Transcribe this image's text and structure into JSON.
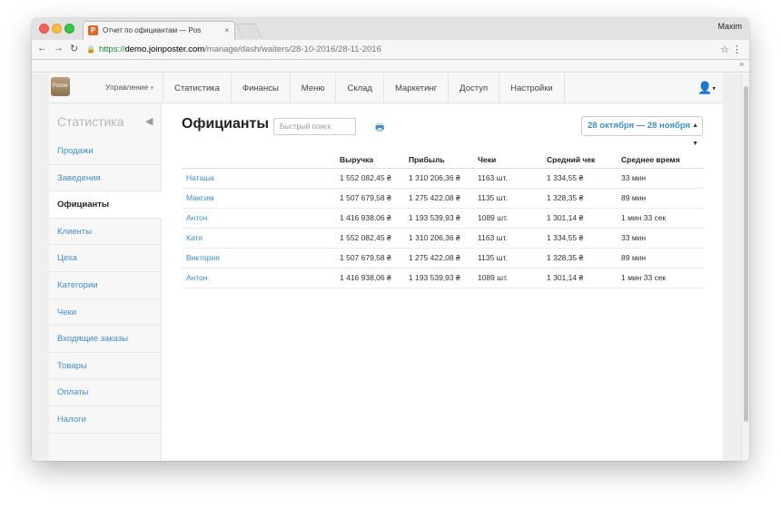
{
  "browser": {
    "tab_title": "Отчет по официантам — Pos",
    "tab_close": "×",
    "user_name": "Maxim",
    "url_secure": "https://",
    "url_host": "demo.joinposter.com",
    "url_path": "/manage/dash/waiters/28-10-2016/28-11-2016"
  },
  "topnav": {
    "logo_text": "Poster",
    "management_label": "Управление",
    "items": [
      "Статистика",
      "Финансы",
      "Меню",
      "Склад",
      "Маркетинг",
      "Доступ",
      "Настройки"
    ]
  },
  "sidebar": {
    "title": "Статистика",
    "items": [
      {
        "label": "Продажи"
      },
      {
        "label": "Заведения"
      },
      {
        "label": "Официанты"
      },
      {
        "label": "Клиенты"
      },
      {
        "label": "Цеха"
      },
      {
        "label": "Категории"
      },
      {
        "label": "Чеки"
      },
      {
        "label": "Входящие заказы"
      },
      {
        "label": "Товары"
      },
      {
        "label": "Оплаты"
      },
      {
        "label": "Налоги"
      }
    ],
    "active_index": 2
  },
  "main": {
    "title": "Официанты",
    "search_placeholder": "Быстрый поиск",
    "date_range": "28 октября — 28 ноября"
  },
  "table": {
    "columns": [
      "",
      "Выручка",
      "Прибыль",
      "Чеки",
      "Средний чек",
      "Среднее время"
    ],
    "rows": [
      [
        "Наташа",
        "1 552 082,45 ₴",
        "1 310 206,36 ₴",
        "1163 шт.",
        "1 334,55 ₴",
        "33 мин"
      ],
      [
        "Максим",
        "1 507 679,58 ₴",
        "1 275 422,08 ₴",
        "1135 шт.",
        "1 328,35 ₴",
        "89 мин"
      ],
      [
        "Антон",
        "1 416 938,06 ₴",
        "1 193 539,93 ₴",
        "1089 шт.",
        "1 301,14 ₴",
        "1 мин 33 сек"
      ],
      [
        "Катя",
        "1 552 082,45 ₴",
        "1 310 206,36 ₴",
        "1163 шт.",
        "1 334,55 ₴",
        "33 мин"
      ],
      [
        "Виктория",
        "1 507 679,58 ₴",
        "1 275 422,08 ₴",
        "1135 шт.",
        "1 328,35 ₴",
        "89 мин"
      ],
      [
        "Антон",
        "1 416 938,06 ₴",
        "1 193 539,93 ₴",
        "1089 шт.",
        "1 301,14 ₴",
        "1 мин 33 сек"
      ]
    ]
  },
  "colors": {
    "accent": "#3e8fd2",
    "sidebar_bg": "#f7f7f7"
  }
}
